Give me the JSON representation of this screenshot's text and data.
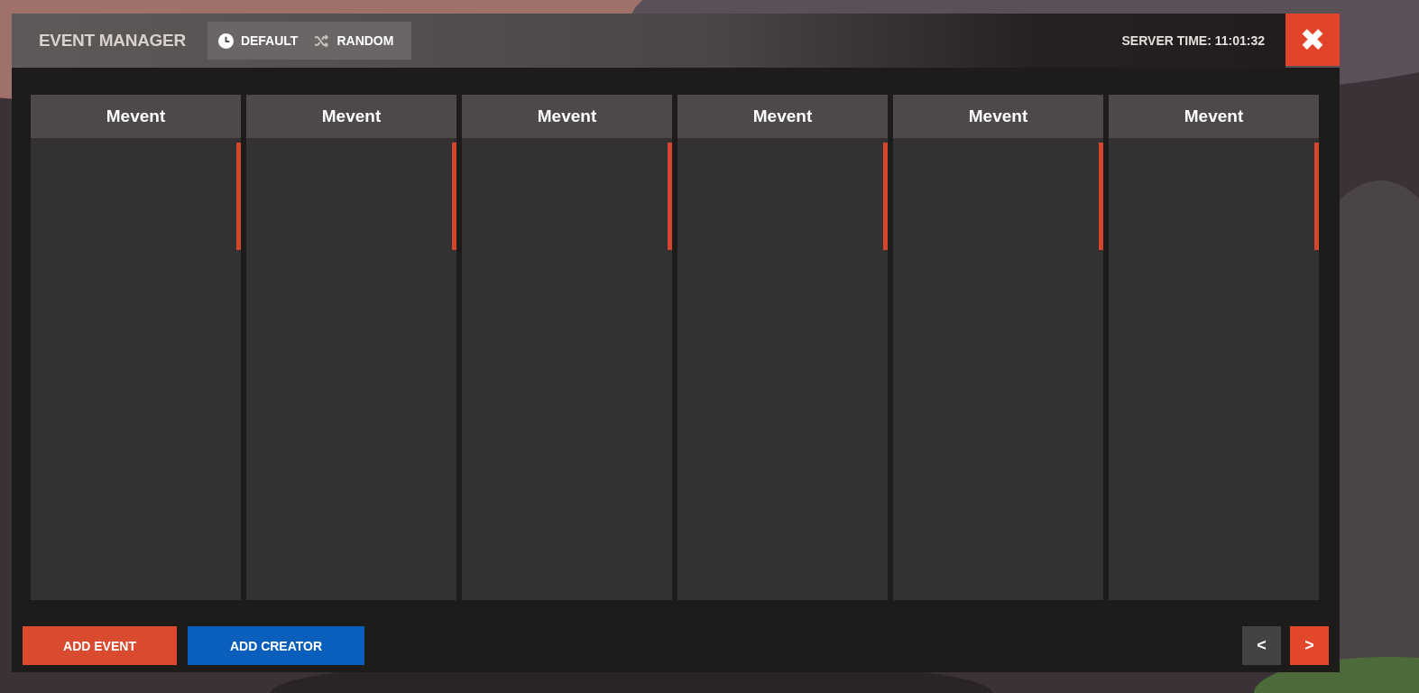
{
  "window": {
    "title": "EVENT MANAGER",
    "server_time": "SERVER TIME: 11:01:32",
    "close": "✖"
  },
  "modes": [
    {
      "label": "DEFAULT",
      "kind": "clock"
    },
    {
      "label": "RANDOM",
      "kind": "shuffle"
    }
  ],
  "columns": [
    {
      "title": "Mevent"
    },
    {
      "title": "Mevent"
    },
    {
      "title": "Mevent"
    },
    {
      "title": "Mevent"
    },
    {
      "title": "Mevent"
    },
    {
      "title": "Mevent"
    }
  ],
  "buttons": [
    {
      "label": "ADD EVENT",
      "kind": "primary"
    },
    {
      "label": "ADD CREATOR",
      "kind": "secondary"
    }
  ],
  "pager": [
    {
      "label": "<",
      "disabled": true
    },
    {
      "label": ">",
      "disabled": false
    }
  ]
}
